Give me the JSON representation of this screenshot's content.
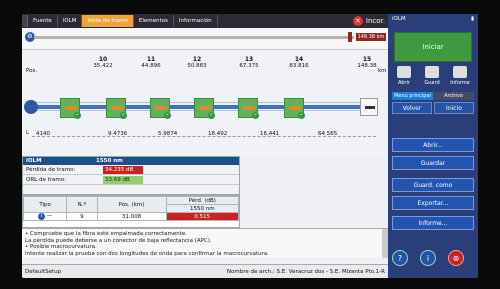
{
  "tabs": [
    {
      "label": "Fuente"
    },
    {
      "label": "iOLM"
    },
    {
      "label": "Vista de tramo"
    },
    {
      "label": "Elementos"
    },
    {
      "label": "Información"
    }
  ],
  "incor": {
    "label": "Incor.",
    "icon": "x-icon"
  },
  "overview": {
    "total_length": "148.38 km"
  },
  "events": [
    {
      "num": "10",
      "pos": "35.422"
    },
    {
      "num": "11",
      "pos": "44.896"
    },
    {
      "num": "12",
      "pos": "50.883"
    },
    {
      "num": "13",
      "pos": "67.375"
    },
    {
      "num": "14",
      "pos": "83.816"
    },
    {
      "num": "15",
      "pos": "148.38"
    }
  ],
  "pos_label": "Pos.",
  "km_label": "km",
  "loss_label": "L",
  "segments": [
    "4140",
    "9.4736",
    "5.9874",
    "16.492",
    "16.441",
    "64.565"
  ],
  "iolm": {
    "title": "iOLM",
    "wavelength": "1550 nm",
    "loss_label": "Pérdida de tramo:",
    "loss_value": "34.235 dB",
    "orl_label": "ORL de tramo:",
    "orl_value": "33.69 dB"
  },
  "event_table": {
    "col_tipo": "Tipo",
    "col_n": "N.º",
    "col_pos": "Pos. (km)",
    "col_perd": "Pérd. (dB)",
    "sub": "1550 nm",
    "row": {
      "n": "9",
      "pos": "31.008",
      "loss": "0.515"
    }
  },
  "diagnostics": [
    "• Compruebe que la fibra esté empalmada correctamente.",
    "La pérdida puede deberse a un conector de baja reflectancia (APC).",
    "• Posible macrocurvatura.",
    "Intente realizar la prueba con dos longitudes de onda para confirmar la macrocurvatura."
  ],
  "status": {
    "setup": "DefaultSetup",
    "filename": "Nombre de arch.: S.E. Veracruz dos - S.E. Mizanta Pto.1-R"
  },
  "sidebar": {
    "title": "iOLM",
    "start": "Iniciar",
    "abrir": "Abrir",
    "guard": "Guard",
    "informe": "Informe",
    "mode_main": "Menú principal",
    "mode_files": "Archivo",
    "volver": "Volver",
    "inicio": "Inicio",
    "menu": [
      "Abrir...",
      "Guardar",
      "Guard. como",
      "Exportar...",
      "Informe..."
    ]
  }
}
